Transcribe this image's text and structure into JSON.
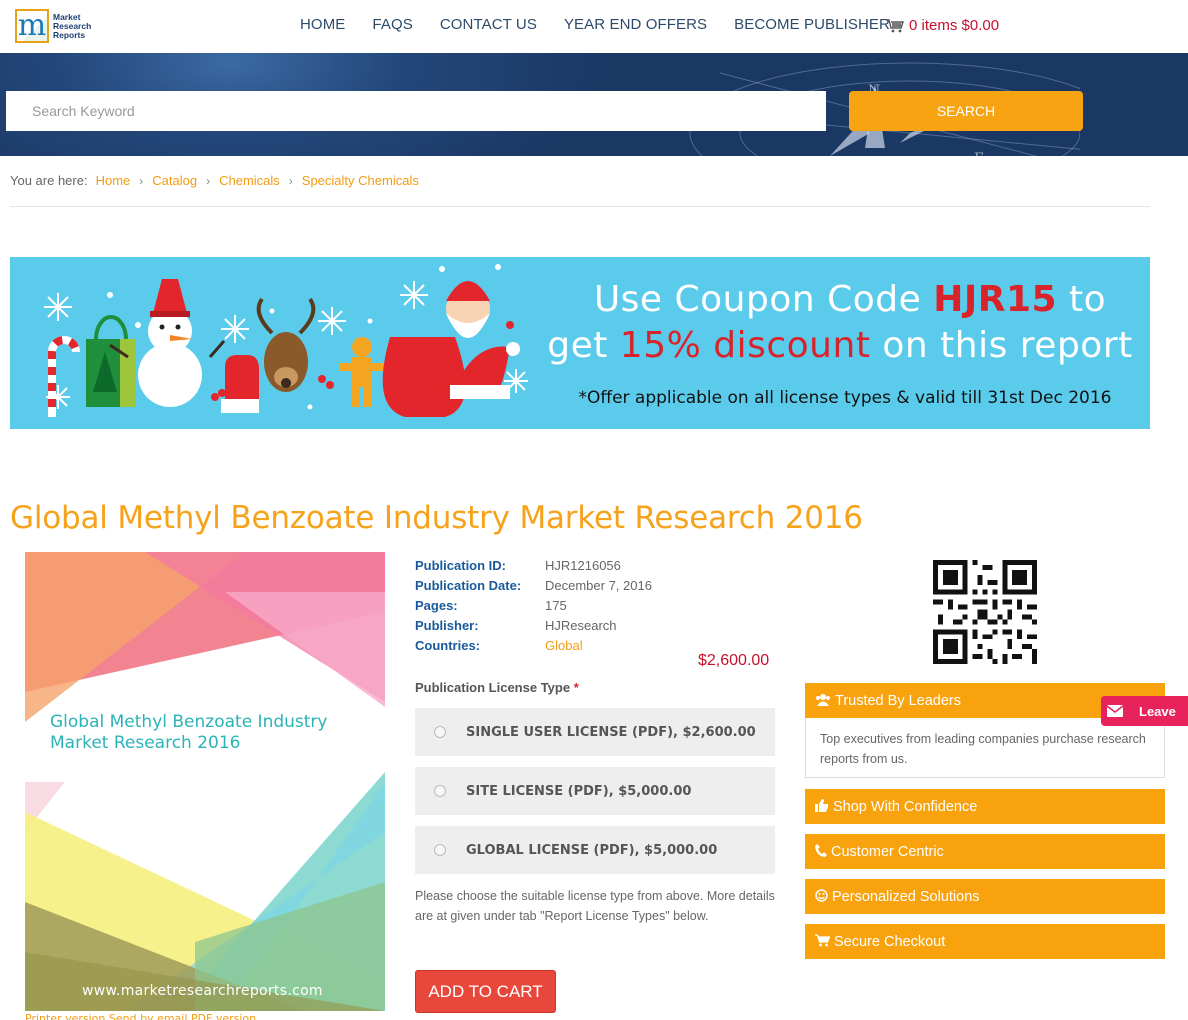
{
  "header": {
    "logo_text": [
      "Market",
      "Research",
      "Reports"
    ],
    "logo_letter": "m",
    "nav": [
      "HOME",
      "FAQS",
      "CONTACT US",
      "YEAR END OFFERS",
      "BECOME PUBLISHER"
    ],
    "cart_label": "0 items $0.00"
  },
  "search": {
    "placeholder": "Search Keyword",
    "button_label": "SEARCH"
  },
  "breadcrumb": {
    "label": "You are here:",
    "items": [
      "Home",
      "Catalog",
      "Chemicals",
      "Specialty Chemicals"
    ]
  },
  "promo": {
    "line1_pre": "Use Coupon Code ",
    "code": "HJR15",
    "line1_post": " to",
    "line2_pre": "get ",
    "discount": "15% discount",
    "line2_post": " on this report",
    "note": "*Offer applicable on all license types & valid till 31st Dec 2016"
  },
  "report": {
    "title": "Global Methyl Benzoate Industry Market Research 2016",
    "cover_title": "Global Methyl Benzoate Industry Market Research 2016",
    "cover_url": "www.marketresearchreports.com",
    "info": [
      {
        "key": "Publication ID:",
        "value": "HJR1216056"
      },
      {
        "key": "Publication Date:",
        "value": "December 7, 2016"
      },
      {
        "key": "Pages:",
        "value": "175"
      },
      {
        "key": "Publisher:",
        "value": "HJResearch"
      },
      {
        "key": "Countries:",
        "value": "Global"
      }
    ],
    "price": "$2,600.00",
    "license_title": "Publication License Type",
    "required_mark": "*",
    "licenses": [
      "SINGLE USER LICENSE (PDF), $2,600.00",
      "SITE LICENSE (PDF), $5,000.00",
      "GLOBAL LICENSE (PDF), $5,000.00"
    ],
    "license_note": "Please choose the suitable license type from above. More details are at given under tab \"Report License Types\" below.",
    "add_to_cart": "ADD TO CART",
    "under_cover": "Printer version   Send by email   PDF version"
  },
  "sidebar": {
    "trusted_title": "Trusted By Leaders",
    "trusted_text": "Top executives from leading companies purchase research reports from us.",
    "items": [
      "Shop With Confidence",
      "Customer Centric",
      "Personalized Solutions",
      "Secure Checkout"
    ],
    "leave_label": "Leave"
  },
  "colors": {
    "accent": "#f7a21b",
    "nav": "#2d4a69",
    "price": "#c8102e",
    "cart_button": "#e8473c",
    "promo_bg": "#5bcbec"
  }
}
